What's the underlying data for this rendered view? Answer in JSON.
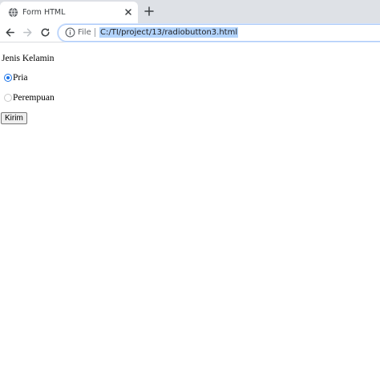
{
  "tab": {
    "title": "Form HTML",
    "favicon": "globe-icon",
    "close_icon": "close-icon"
  },
  "toolbar": {
    "back_icon": "arrow-left-icon",
    "forward_icon": "arrow-right-icon",
    "reload_icon": "reload-icon",
    "new_tab_icon": "plus-icon"
  },
  "omnibox": {
    "info_icon": "info-icon",
    "scheme_label": "File",
    "url": "C:/TI/project/13/radiobutton3.html"
  },
  "form": {
    "heading": "Jenis Kelamin",
    "options": [
      {
        "label": "Pria",
        "checked": true
      },
      {
        "label": "Perempuan",
        "checked": false
      }
    ],
    "submit_label": "Kirim"
  },
  "colors": {
    "accent": "#1a73e8",
    "url_highlight": "#b3d4fc",
    "tabstrip": "#dee1e6"
  }
}
